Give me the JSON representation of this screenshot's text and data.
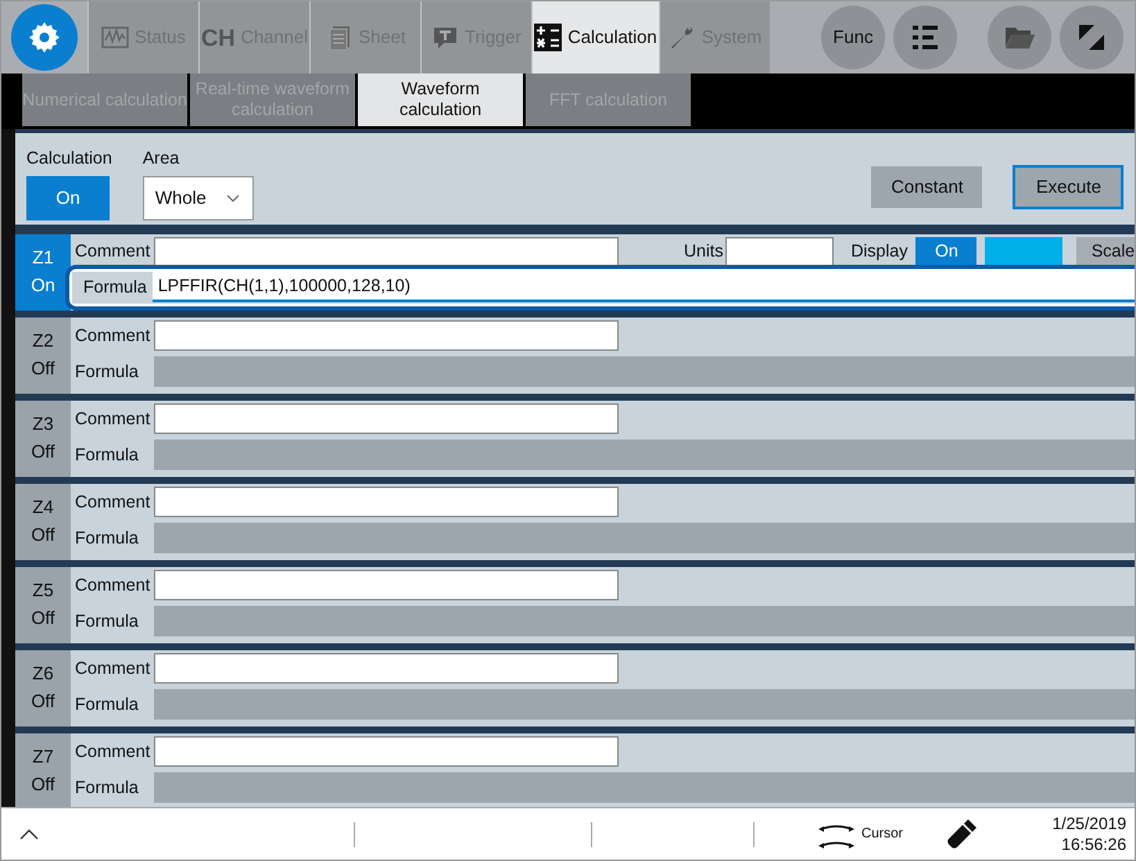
{
  "top_tabs": [
    {
      "label": "Status",
      "selected": false
    },
    {
      "label": "Channel",
      "mark": "CH",
      "selected": false
    },
    {
      "label": "Sheet",
      "selected": false
    },
    {
      "label": "Trigger",
      "selected": false
    },
    {
      "label": "Calculation",
      "selected": true
    },
    {
      "label": "System",
      "selected": false
    }
  ],
  "func_button": "Func",
  "sub_tabs": [
    {
      "label": "Numerical calculation",
      "selected": false
    },
    {
      "label": "Real-time waveform calculation",
      "selected": false
    },
    {
      "label": "Waveform calculation",
      "selected": true
    },
    {
      "label": "FFT calculation",
      "selected": false
    }
  ],
  "calculation": {
    "label": "Calculation",
    "value": "On",
    "on": true
  },
  "area": {
    "label": "Area",
    "value": "Whole"
  },
  "constant_button": "Constant",
  "execute_button": "Execute",
  "rows": [
    {
      "name": "Z1",
      "state": "On",
      "on": true,
      "comment_label": "Comment",
      "formula_label": "Formula",
      "formula": "LPFFIR(CH(1,1),100000,128,10)",
      "units_label": "Units",
      "display_label": "Display",
      "display_value": "On",
      "scale_button": "Scale"
    },
    {
      "name": "Z2",
      "state": "Off",
      "on": false,
      "comment_label": "Comment",
      "formula_label": "Formula"
    },
    {
      "name": "Z3",
      "state": "Off",
      "on": false,
      "comment_label": "Comment",
      "formula_label": "Formula"
    },
    {
      "name": "Z4",
      "state": "Off",
      "on": false,
      "comment_label": "Comment",
      "formula_label": "Formula"
    },
    {
      "name": "Z5",
      "state": "Off",
      "on": false,
      "comment_label": "Comment",
      "formula_label": "Formula"
    },
    {
      "name": "Z6",
      "state": "Off",
      "on": false,
      "comment_label": "Comment",
      "formula_label": "Formula"
    },
    {
      "name": "Z7",
      "state": "Off",
      "on": false,
      "comment_label": "Comment",
      "formula_label": "Formula"
    }
  ],
  "status_bar": {
    "cursor_label": "Cursor",
    "date": "1/25/2019",
    "time": "16:56:26"
  }
}
